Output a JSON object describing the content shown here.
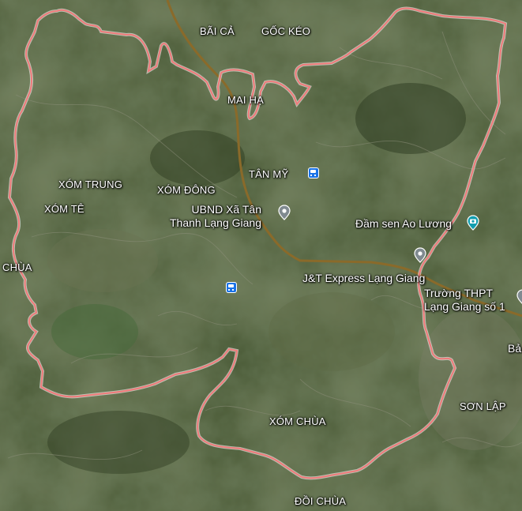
{
  "map": {
    "boundary_color": "#f07a7a",
    "road_color": "#8a6a2a",
    "labels": {
      "bai_ca": "BÃI CẢ",
      "goc_keo": "GỐC KÉO",
      "mai_ha": "MAI HẠ",
      "tan_my": "TÂN MỸ",
      "xom_trung": "XÓM TRUNG",
      "xom_dong": "XÓM ĐÔNG",
      "xom_te": "XÓM TÊ",
      "chua_left": "CHÙA",
      "xom_chua": "XÓM CHÙA",
      "son_lap": "SƠN LẬP",
      "doi_chua": "ĐỒI CHÙA"
    },
    "pois": {
      "ubnd_line1": "UBND Xã Tân",
      "ubnd_line2": "Thanh Lạng Giang",
      "dam_sen": "Đầm sen Ao Lương",
      "jt_express": "J&T Express Lạng Giang",
      "truong_line1": "Trường THPT",
      "truong_line2": "Lạng Giang số 1",
      "edge_ba": "Bả"
    },
    "icons": {
      "pin": "location-pin-icon",
      "bus": "bus-stop-icon",
      "camera": "camera-icon"
    }
  }
}
